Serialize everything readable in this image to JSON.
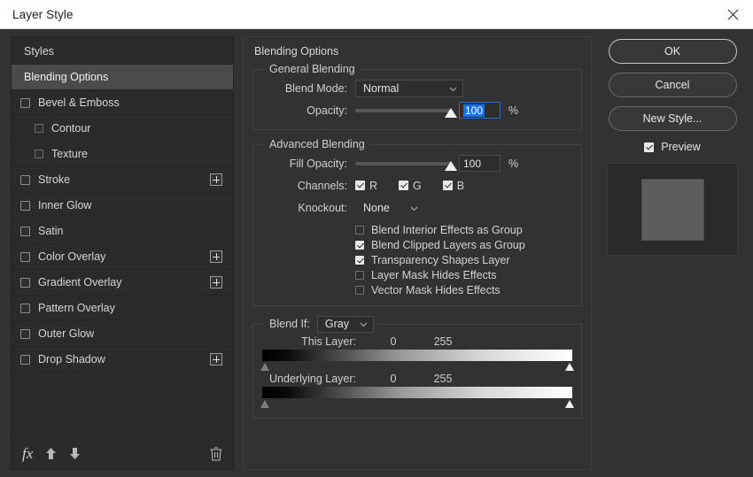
{
  "window": {
    "title": "Layer Style",
    "close_icon": "close-icon"
  },
  "sidebar": {
    "items": [
      {
        "label": "Styles",
        "type": "plain",
        "selected": false
      },
      {
        "label": "Blending Options",
        "type": "plain",
        "selected": true
      },
      {
        "label": "Bevel & Emboss",
        "type": "checkbox",
        "checked": false
      },
      {
        "label": "Contour",
        "type": "sub",
        "checked": false
      },
      {
        "label": "Texture",
        "type": "sub",
        "checked": false
      },
      {
        "label": "Stroke",
        "type": "checkbox",
        "checked": false,
        "plus": true
      },
      {
        "label": "Inner Glow",
        "type": "checkbox",
        "checked": false
      },
      {
        "label": "Satin",
        "type": "checkbox",
        "checked": false
      },
      {
        "label": "Color Overlay",
        "type": "checkbox",
        "checked": false,
        "plus": true
      },
      {
        "label": "Gradient Overlay",
        "type": "checkbox",
        "checked": false,
        "plus": true
      },
      {
        "label": "Pattern Overlay",
        "type": "checkbox",
        "checked": false
      },
      {
        "label": "Outer Glow",
        "type": "checkbox",
        "checked": false
      },
      {
        "label": "Drop Shadow",
        "type": "checkbox",
        "checked": false,
        "plus": true
      }
    ],
    "toolbar": {
      "fx_label": "fx",
      "fx_icon": "fx-icon",
      "move_up_icon": "arrow-up-icon",
      "move_down_icon": "arrow-down-icon",
      "delete_icon": "trash-icon"
    }
  },
  "main": {
    "heading": "Blending Options",
    "general_blending": {
      "legend": "General Blending",
      "blend_mode_label": "Blend Mode:",
      "blend_mode_value": "Normal",
      "opacity_label": "Opacity:",
      "opacity_value": "100",
      "opacity_unit": "%",
      "opacity_percent": 100
    },
    "advanced_blending": {
      "legend": "Advanced Blending",
      "fill_opacity_label": "Fill Opacity:",
      "fill_opacity_value": "100",
      "fill_opacity_unit": "%",
      "fill_opacity_percent": 100,
      "channels_label": "Channels:",
      "channels": [
        {
          "label": "R",
          "checked": true
        },
        {
          "label": "G",
          "checked": true
        },
        {
          "label": "B",
          "checked": true
        }
      ],
      "knockout_label": "Knockout:",
      "knockout_value": "None",
      "options": [
        {
          "label": "Blend Interior Effects as Group",
          "checked": false
        },
        {
          "label": "Blend Clipped Layers as Group",
          "checked": true
        },
        {
          "label": "Transparency Shapes Layer",
          "checked": true
        },
        {
          "label": "Layer Mask Hides Effects",
          "checked": false
        },
        {
          "label": "Vector Mask Hides Effects",
          "checked": false
        }
      ]
    },
    "blend_if": {
      "label": "Blend If:",
      "channel_value": "Gray",
      "this_layer": {
        "label": "This Layer:",
        "min": "0",
        "max": "255"
      },
      "underlying_layer": {
        "label": "Underlying Layer:",
        "min": "0",
        "max": "255"
      }
    }
  },
  "actions": {
    "ok_label": "OK",
    "cancel_label": "Cancel",
    "new_style_label": "New Style...",
    "preview_label": "Preview",
    "preview_checked": true
  },
  "colors": {
    "accent": "#1473e6",
    "dialog_bg": "#323232",
    "sidebar_bg": "#2b2b2b",
    "selected_row": "#4b4b4b",
    "titlebar_bg": "#ffffff",
    "swatch": "#5d5d5d"
  }
}
